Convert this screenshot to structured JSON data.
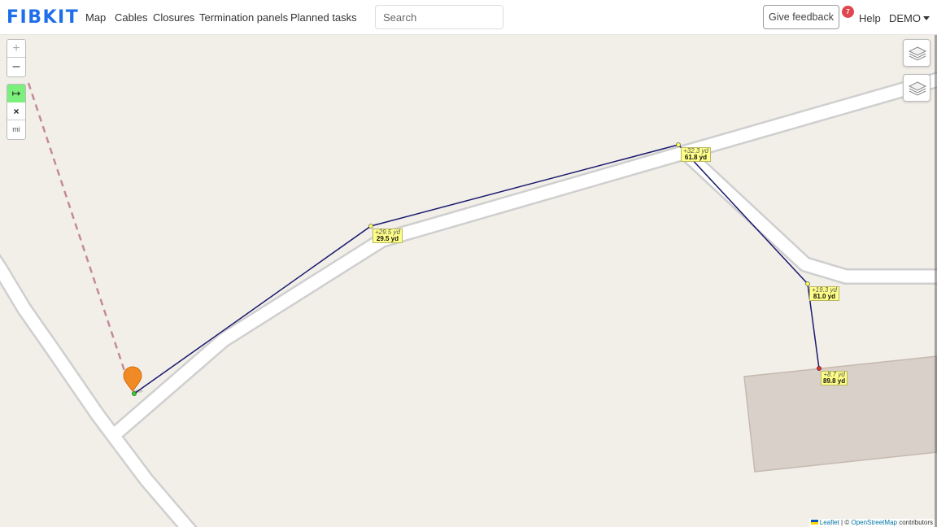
{
  "navbar": {
    "brand": "FIBKIT",
    "links": [
      "Map",
      "Cables",
      "Closures",
      "Termination panels",
      "Planned tasks"
    ],
    "search_placeholder": "Search",
    "feedback_label": "Give feedback",
    "notification_count": "7",
    "help_label": "Help",
    "user_label": "DEMO"
  },
  "map": {
    "zoom_in": "+",
    "zoom_out": "–",
    "measure_tool": "↦",
    "measure_clear": "×",
    "measure_unit": "mi",
    "measurements": [
      {
        "delta": "+29.5 yd",
        "total": "29.5 yd"
      },
      {
        "delta": "+32.3 yd",
        "total": "61.8 yd"
      },
      {
        "delta": "+19.3 yd",
        "total": "81.0 yd"
      },
      {
        "delta": "+8.7 yd",
        "total": "89.8 yd"
      }
    ],
    "attribution": {
      "leaflet": "Leaflet",
      "separator": "| ©",
      "osm": "OpenStreetMap",
      "suffix": "contributors"
    }
  },
  "colors": {
    "brand": "#1f6feb",
    "badge": "#e0464f",
    "measure_line": "#1a1a6e",
    "dashed_line": "#c48a95",
    "marker": "#f08a24",
    "label_bg": "#ffff88",
    "active_tool": "#7cf07c"
  }
}
